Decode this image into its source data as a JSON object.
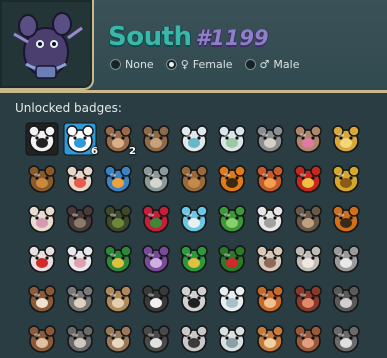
{
  "profile": {
    "name": "South",
    "tag": "#1199",
    "gender_options": [
      {
        "label": "None",
        "symbol": "",
        "selected": false
      },
      {
        "label": "Female",
        "symbol": "♀",
        "selected": true
      },
      {
        "label": "Male",
        "symbol": "♂",
        "selected": false
      }
    ]
  },
  "badges_section": {
    "title": "Unlocked badges:",
    "items": [
      {
        "icon": "panda-badge-icon",
        "bg": "#222222",
        "fg": "#f2f2f2",
        "kind": "dark"
      },
      {
        "icon": "checkered-mouse-badge-icon",
        "bg": "#2f9ad8",
        "fg": "#ffffff",
        "kind": "dark",
        "count": "6"
      },
      {
        "icon": "mouse-trio-badge-icon",
        "bg": "#9a6b4a",
        "fg": "#d9b08a",
        "count": "2"
      },
      {
        "icon": "mouse-pair-badge-icon",
        "bg": "#8c6a4a",
        "fg": "#c8a07a"
      },
      {
        "icon": "white-rat-badge-icon",
        "bg": "#dfe8ea",
        "fg": "#6ab6c9"
      },
      {
        "icon": "winged-shield-badge-icon",
        "bg": "#d8e6ea",
        "fg": "#9ec8a0"
      },
      {
        "icon": "mouse-with-hat-badge-icon",
        "bg": "#8a8f92",
        "fg": "#d6d0c4"
      },
      {
        "icon": "mouse-with-bow-badge-icon",
        "bg": "#b0876a",
        "fg": "#e07aa8"
      },
      {
        "icon": "golden-bell-badge-icon",
        "bg": "#d8a93a",
        "fg": "#f4d67a"
      },
      {
        "icon": "easter-egg-badge-icon",
        "bg": "#8a5a2a",
        "fg": "#c9893e"
      },
      {
        "icon": "birthday-cake-badge-icon",
        "bg": "#e6d7c8",
        "fg": "#e85a4a"
      },
      {
        "icon": "goldfish-bowl-badge-icon",
        "bg": "#3a84c6",
        "fg": "#f2a23a"
      },
      {
        "icon": "cheese-wedge-badge-icon",
        "bg": "#8a9a9a",
        "fg": "#d6d6cf"
      },
      {
        "icon": "bucket-badge-icon",
        "bg": "#9a6a3a",
        "fg": "#c48a4a"
      },
      {
        "icon": "jack-o-lantern-badge-icon",
        "bg": "#e07a1a",
        "fg": "#3a2a10"
      },
      {
        "icon": "candy-badge-icon",
        "bg": "#c95a2a",
        "fg": "#f0a050"
      },
      {
        "icon": "christmas-bauble-badge-icon",
        "bg": "#c8281e",
        "fg": "#f0c040"
      },
      {
        "icon": "gift-box-badge-icon",
        "bg": "#d6a82a",
        "fg": "#8a5a1a"
      },
      {
        "icon": "bunny-badge-icon",
        "bg": "#e8dcd0",
        "fg": "#d79ab0"
      },
      {
        "icon": "bat-badge-icon",
        "bg": "#4a3a3a",
        "fg": "#8a7a6a"
      },
      {
        "icon": "cauldron-badge-icon",
        "bg": "#3e4a2a",
        "fg": "#6a8a3a"
      },
      {
        "icon": "rose-badge-icon",
        "bg": "#c81e3a",
        "fg": "#3a8a3a"
      },
      {
        "icon": "fairy-badge-icon",
        "bg": "#6ac8e6",
        "fg": "#e8f0f0"
      },
      {
        "icon": "clover-badge-icon",
        "bg": "#3a9a3a",
        "fg": "#8ad06a"
      },
      {
        "icon": "chef-hat-badge-icon",
        "bg": "#e6e6e6",
        "fg": "#a0a0a0"
      },
      {
        "icon": "mouse-with-helmet-badge-icon",
        "bg": "#6a5a4a",
        "fg": "#c0a080"
      },
      {
        "icon": "pumpkin-mouse-badge-icon",
        "bg": "#d0701a",
        "fg": "#3a2a1a"
      },
      {
        "icon": "candy-cane-badge-icon",
        "bg": "#e8e0e0",
        "fg": "#d02a2a"
      },
      {
        "icon": "swan-badge-icon",
        "bg": "#e8e8ec",
        "fg": "#e0a0b0"
      },
      {
        "icon": "christmas-tree-badge-icon",
        "bg": "#2a8a3a",
        "fg": "#e0c040"
      },
      {
        "icon": "purple-mouse-badge-icon",
        "bg": "#7a4a9a",
        "fg": "#d0b0e0"
      },
      {
        "icon": "leprechaun-hat-badge-icon",
        "bg": "#2a9a3a",
        "fg": "#e0c040"
      },
      {
        "icon": "wreath-badge-icon",
        "bg": "#2a7a2a",
        "fg": "#d02a2a"
      },
      {
        "icon": "mice-group-badge-icon",
        "bg": "#d8c8b8",
        "fg": "#8a6a5a"
      },
      {
        "icon": "grey-mouse-badge-icon",
        "bg": "#c0bcb8",
        "fg": "#f0e8e0"
      },
      {
        "icon": "mouse-skeleton-badge-icon",
        "bg": "#9a9a9a",
        "fg": "#e8e8e8"
      },
      {
        "icon": "brown-mouse-badge-icon",
        "bg": "#8a5a3a",
        "fg": "#f0e0d0"
      },
      {
        "icon": "scared-mouse-badge-icon",
        "bg": "#7a7a7a",
        "fg": "#e0d0c0"
      },
      {
        "icon": "tabby-mouse-badge-icon",
        "bg": "#b08a5a",
        "fg": "#e0d0b0"
      },
      {
        "icon": "panda-mouse-badge-icon",
        "bg": "#3a3a3a",
        "fg": "#f0f0f0"
      },
      {
        "icon": "zebra-mouse-badge-icon",
        "bg": "#d0d0d0",
        "fg": "#202020"
      },
      {
        "icon": "yeti-badge-icon",
        "bg": "#e8eef0",
        "fg": "#a8c0c8"
      },
      {
        "icon": "orange-mouse-badge-icon",
        "bg": "#c86a2a",
        "fg": "#f0c090"
      },
      {
        "icon": "red-mouse-badge-icon",
        "bg": "#8a3a2a",
        "fg": "#e08a6a"
      },
      {
        "icon": "raccoon-mouse-badge-icon",
        "bg": "#5a5a5a",
        "fg": "#d0d0d0"
      },
      {
        "icon": "mouse-row-6-1-badge-icon",
        "bg": "#8a5a3a",
        "fg": "#e0c0a0"
      },
      {
        "icon": "mouse-row-6-2-badge-icon",
        "bg": "#6a6a6a",
        "fg": "#d0c8c0"
      },
      {
        "icon": "mouse-row-6-3-badge-icon",
        "bg": "#9a7a5a",
        "fg": "#e8d8c0"
      },
      {
        "icon": "mouse-row-6-4-badge-icon",
        "bg": "#4a4a4a",
        "fg": "#e0e0e0"
      },
      {
        "icon": "mouse-row-6-5-badge-icon",
        "bg": "#c8c8c8",
        "fg": "#3a3a3a"
      },
      {
        "icon": "mouse-row-6-6-badge-icon",
        "bg": "#d8e0e0",
        "fg": "#8aa0a8"
      },
      {
        "icon": "mouse-row-6-7-badge-icon",
        "bg": "#c87a3a",
        "fg": "#f0d0a0"
      },
      {
        "icon": "mouse-row-6-8-badge-icon",
        "bg": "#9a5a3a",
        "fg": "#e0a080"
      },
      {
        "icon": "mouse-row-6-9-badge-icon",
        "bg": "#6a6a6a",
        "fg": "#e0e0e0"
      }
    ]
  }
}
